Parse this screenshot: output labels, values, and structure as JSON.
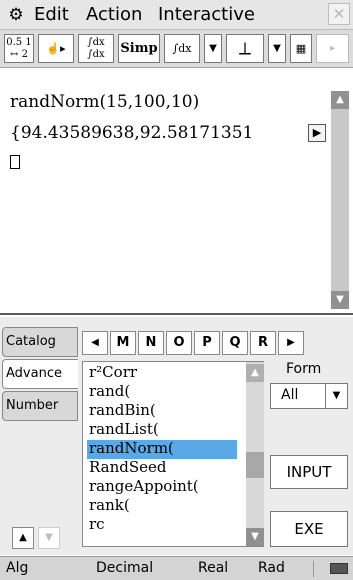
{
  "menubar": {
    "gear_icon": "⚙",
    "items": [
      "Edit",
      "Action",
      "Interactive"
    ],
    "close_icon": "✕"
  },
  "toolbar": {
    "buttons": [
      {
        "label": "0.5 1\n ↔ 2",
        "icon": "fraction-decimal-toggle-icon"
      },
      {
        "label": "☝▸",
        "icon": "drag-hand-icon"
      },
      {
        "label": "∫dx\n∫dx",
        "icon": "integral-stack-icon"
      },
      {
        "label": "Simp",
        "icon": "simplify-icon"
      },
      {
        "label": "∫dx",
        "icon": "integral-edit-icon"
      },
      {
        "label": "▼",
        "icon": "dropdown-icon"
      },
      {
        "label": "⟂",
        "icon": "graph-axes-icon"
      },
      {
        "label": "▼",
        "icon": "dropdown-icon"
      },
      {
        "label": "▦",
        "icon": "table-icon"
      },
      {
        "label": "▸",
        "icon": "scroll-right-icon"
      }
    ]
  },
  "work": {
    "line1": "randNorm(15,100,10)",
    "line2": "{94.43589638,92.58171351",
    "line2_more": "▶"
  },
  "keyboard": {
    "tabs": [
      "Catalog",
      "Advance",
      "Number"
    ],
    "letters": [
      "M",
      "N",
      "O",
      "P",
      "Q",
      "R"
    ],
    "catalog_items": [
      "r²Corr",
      "rand(",
      "randBin(",
      "randList(",
      "randNorm(",
      "RandSeed",
      "rangeAppoint(",
      "rank(",
      "rc"
    ],
    "selected_item": "randNorm(",
    "form_label": "Form",
    "form_value": "All",
    "input_label": "INPUT",
    "exe_label": "EXE"
  },
  "status": {
    "mode": "Alg",
    "number_format": "Decimal",
    "domain": "Real",
    "angle": "Rad"
  },
  "colors": {
    "selection": "#5aa9e6",
    "scrollbar": "#c8c8c8"
  }
}
